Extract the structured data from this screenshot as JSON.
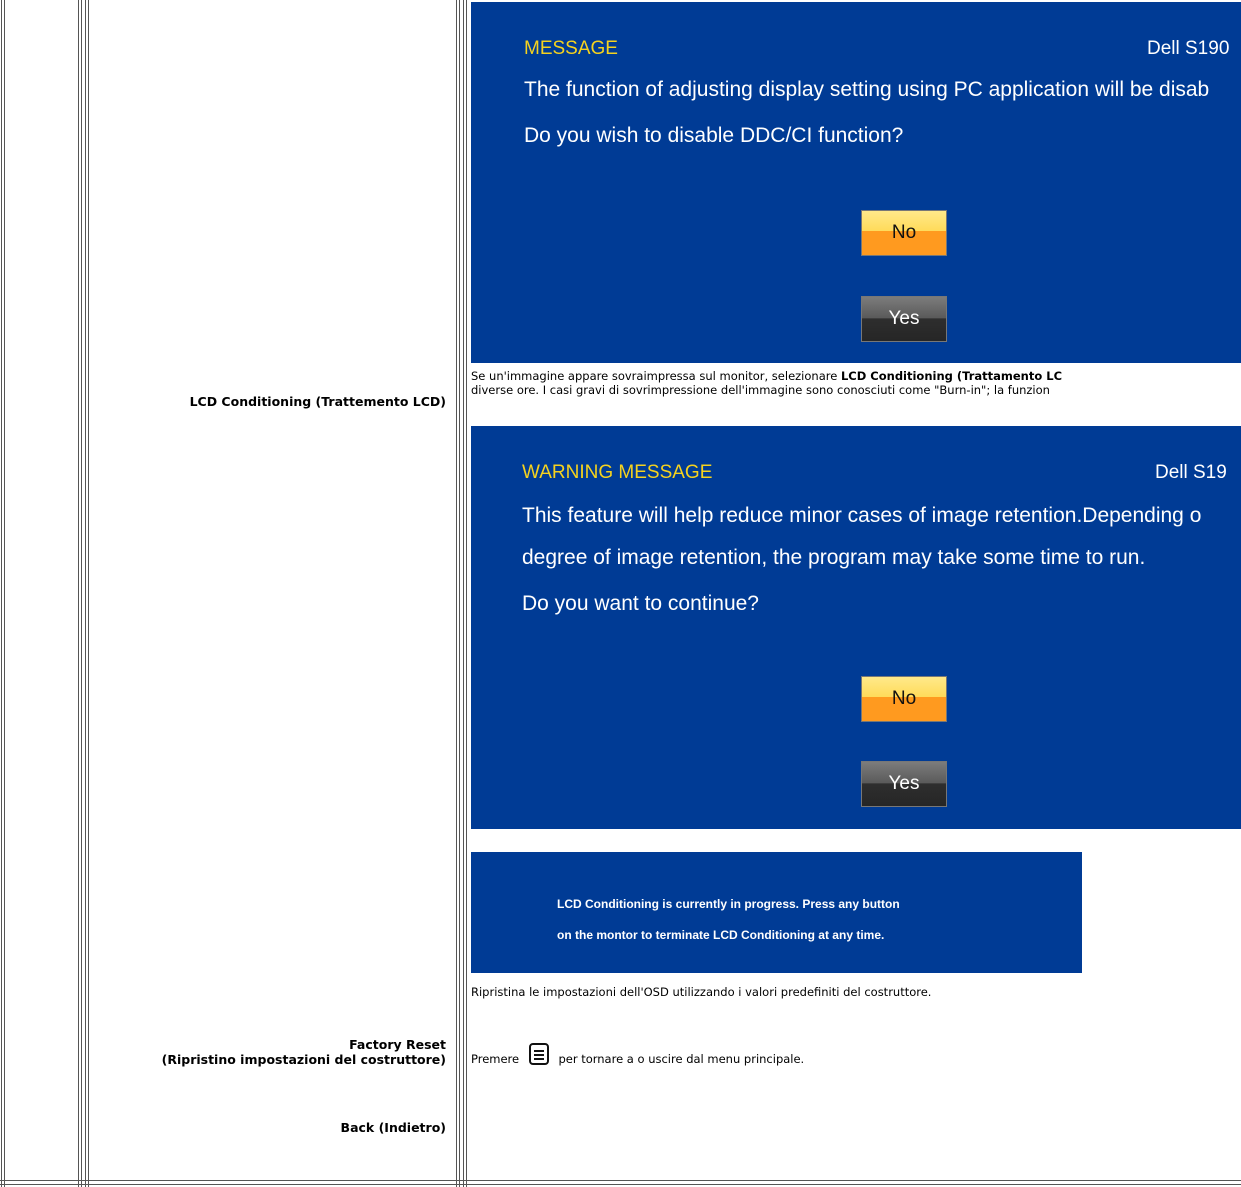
{
  "rows": {
    "lcd": {
      "label": "LCD Conditioning (Trattemento LCD)",
      "description_line1_prefix": "Se un'immagine appare sovraimpressa sul monitor, selezionare ",
      "description_line1_bold": "LCD Conditioning (Trattamento LC",
      "description_line2": "diverse ore. I casi gravi di sovrimpressione dell'immagine sono conosciuti come \"Burn-in\"; la funzion"
    },
    "factory": {
      "label_line1": "Factory Reset",
      "label_line2": "(Ripristino impostazioni del costruttore)",
      "description": "Ripristina le impostazioni dell'OSD utilizzando i valori predefiniti del costruttore."
    },
    "back": {
      "label": "Back (Indietro)",
      "description_prefix": "Premere",
      "description_suffix": "per tornare a o uscire dal menu principale."
    }
  },
  "osd_ddc": {
    "title": "MESSAGE",
    "model": "Dell S190",
    "line1": "The function of adjusting display setting using PC application will be disab",
    "line2": "Do you wish to disable DDC/CI function?",
    "no_label": "No",
    "yes_label": "Yes"
  },
  "osd_warning": {
    "title": "WARNING MESSAGE",
    "model": "Dell S19",
    "line1": "This feature will help reduce minor cases of image retention.Depending o",
    "line2": "degree of image retention, the program may take some time to run.",
    "line3": "Do you want to continue?",
    "no_label": "No",
    "yes_label": "Yes"
  },
  "osd_progress": {
    "line1": "LCD Conditioning is currently in progress. Press any button",
    "line2": "on the montor to terminate LCD Conditioning at any time."
  },
  "icons": {
    "menu": "menu-button-icon"
  },
  "colors": {
    "osd_bg": "#003b95",
    "osd_title": "#f5d21e",
    "no_button": "#ff9a1f",
    "yes_button": "#2e2e2e"
  }
}
